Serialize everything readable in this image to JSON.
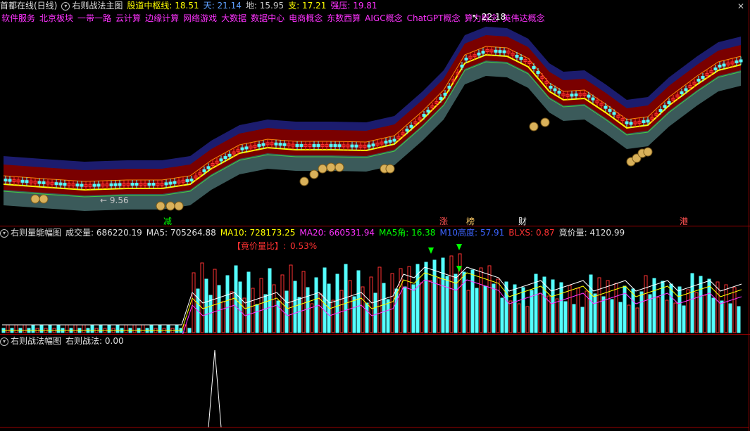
{
  "main": {
    "title_prefix": "首都在线(日线)",
    "indicator_name": "右则战法主图",
    "gudao_label": "股道中枢线:",
    "gudao_value": "18.51",
    "tian_label": "天:",
    "tian_value": "21.14",
    "di_label": "地:",
    "di_value": "15.95",
    "zhi_label": "支:",
    "zhi_value": "17.21",
    "ya_label": "强压:",
    "ya_value": "19.81",
    "high_marker": "22.18",
    "low_marker": "9.56",
    "concepts": [
      "软件服务",
      "北京板块",
      "一带一路",
      "云计算",
      "边缘计算",
      "网络游戏",
      "大数据",
      "数据中心",
      "电商概念",
      "东数西算",
      "AIGC概念",
      "ChatGPT概念",
      "算力概念",
      "英伟达概念"
    ],
    "bottom_tags": [
      "减",
      "涨",
      "榜",
      "财",
      "港"
    ]
  },
  "volume": {
    "indicator_name": "右则量能幅图",
    "vol_label": "成交量:",
    "vol_value": "686220.19",
    "ma5_label": "MA5:",
    "ma5_value": "705264.88",
    "ma10_label": "MA10:",
    "ma10_value": "728173.25",
    "ma20_label": "MA20:",
    "ma20_value": "660531.94",
    "ma5deg_label": "MA5角:",
    "ma5deg_value": "16.38",
    "m10h_label": "M10高度:",
    "m10h_value": "57.91",
    "blxs_label": "BLXS:",
    "blxs_value": "0.87",
    "jjl_label": "竟价量:",
    "jjl_value": "4120.99",
    "jjlb_label": "【竟价量比】:",
    "jjlb_value": "0.53%"
  },
  "tactic": {
    "indicator_name": "右则战法幅图",
    "value_label": "右则战法:",
    "value": "0.00"
  },
  "colors": {
    "up": "#ff3232",
    "down": "#54ffff",
    "yellow": "#ffff00",
    "magenta": "#ff33ff",
    "green": "#00ff00",
    "dark_red_band": "#7a0000",
    "gray_band": "#3b5a5a",
    "navy_band": "#1c1c6e"
  },
  "icons": [
    "money-bag-icon",
    "green-down-arrow-icon",
    "close-icon",
    "dropdown-icon"
  ]
}
